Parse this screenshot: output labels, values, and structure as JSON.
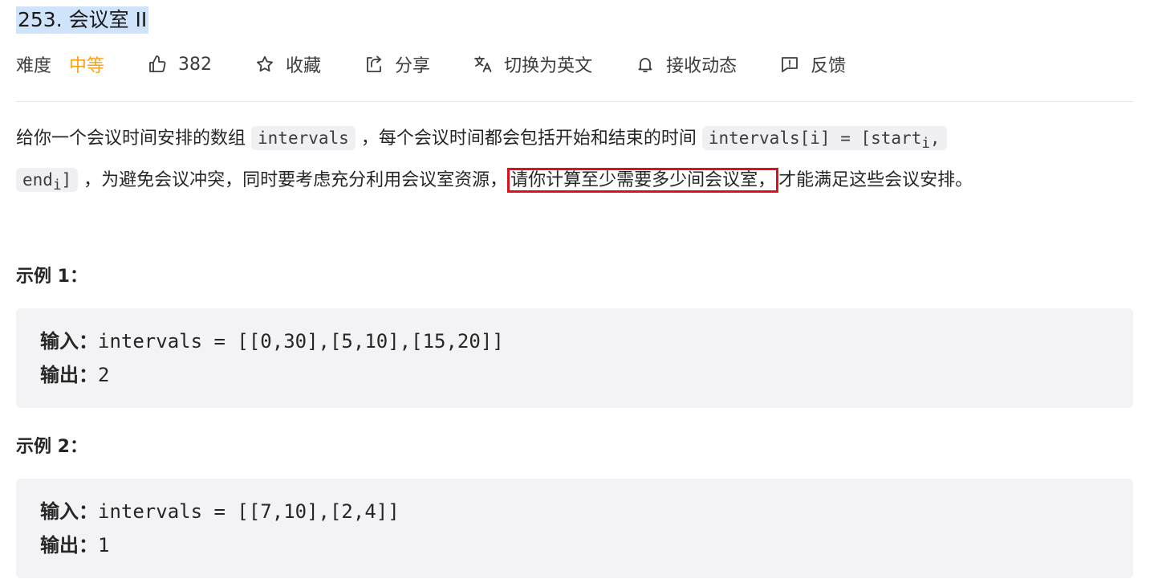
{
  "problem": {
    "title": "253. 会议室 II"
  },
  "meta": {
    "difficulty_label": "难度",
    "difficulty_value": "中等",
    "likes": "382",
    "favorite_label": "收藏",
    "share_label": "分享",
    "translate_label": "切换为英文",
    "notify_label": "接收动态",
    "feedback_label": "反馈"
  },
  "description": {
    "part1": "给你一个会议时间安排的数组",
    "code1": "intervals",
    "part2": "，每个会议时间都会包括开始和结束的时间",
    "code2_a": "intervals[i] = [start",
    "code2_sub1": "i",
    "code2_b": ",",
    "code3_a": "end",
    "code3_sub": "i",
    "code3_b": "]",
    "part3": "，为避免会议冲突，同时要考虑充分利用会议室资源，",
    "highlight": "请你计算至少需要多少间会议室，",
    "part4": "才能满足这些会议安排。"
  },
  "examples": [
    {
      "title": "示例 1：",
      "input_label": "输入：",
      "input_value": "intervals = [[0,30],[5,10],[15,20]]",
      "output_label": "输出：",
      "output_value": "2"
    },
    {
      "title": "示例 2：",
      "input_label": "输入：",
      "input_value": "intervals = [[7,10],[2,4]]",
      "output_label": "输出：",
      "output_value": "1"
    }
  ],
  "icons": [
    "thumbs-up-icon",
    "star-icon",
    "share-icon",
    "translate-icon",
    "bell-icon",
    "feedback-icon"
  ],
  "colors": {
    "difficulty_medium": "#ffa116",
    "title_highlight": "#cfe3fb",
    "annotation_red": "#e0101a",
    "code_bg": "#f0f0f2"
  }
}
